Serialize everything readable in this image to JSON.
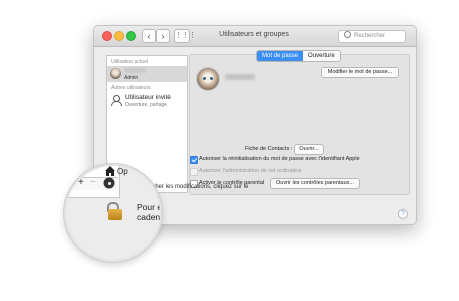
{
  "window": {
    "title": "Utilisateurs et groupes",
    "search_placeholder": "Rechercher"
  },
  "sidebar": {
    "current_user_heading": "Utilisateur actuel",
    "current_user_role": "Admin",
    "other_users_heading": "Autres utilisateurs",
    "guest_name": "Utilisateur invité",
    "guest_status": "Ouverture, partage"
  },
  "tabs": [
    {
      "label": "Mot de passe",
      "active": true
    },
    {
      "label": "Ouverture",
      "active": false
    }
  ],
  "panel": {
    "change_password_button": "Modifier le mot de passe...",
    "contacts_card_label": "Fiche de Contacts :",
    "open_button": "Ouvrir...",
    "checkbox_apple_id": {
      "label": "Autoriser la réinitialisation du mot de passe avec l'identifiant Apple",
      "checked": true,
      "enabled": true
    },
    "checkbox_admin": {
      "label": "Autoriser l'administration de cet ordinateur",
      "checked": true,
      "enabled": false
    },
    "checkbox_parental": {
      "label": "Activer le contrôle parental",
      "checked": false,
      "enabled": true
    },
    "parental_controls_button": "Ouvrir les contrôles parentaux..."
  },
  "footer": {
    "lock_text": "Pour empêcher les modifications, cliquez sur le cadenas.",
    "help_glyph": "?"
  },
  "magnifier": {
    "options_label": "Op",
    "add_glyph": "+",
    "remove_glyph": "−",
    "lock_text_line1": "Pour emp",
    "lock_text_line2": "cadenas."
  },
  "colors": {
    "accent": "#3b8ff4",
    "lock": "#d9a233"
  }
}
